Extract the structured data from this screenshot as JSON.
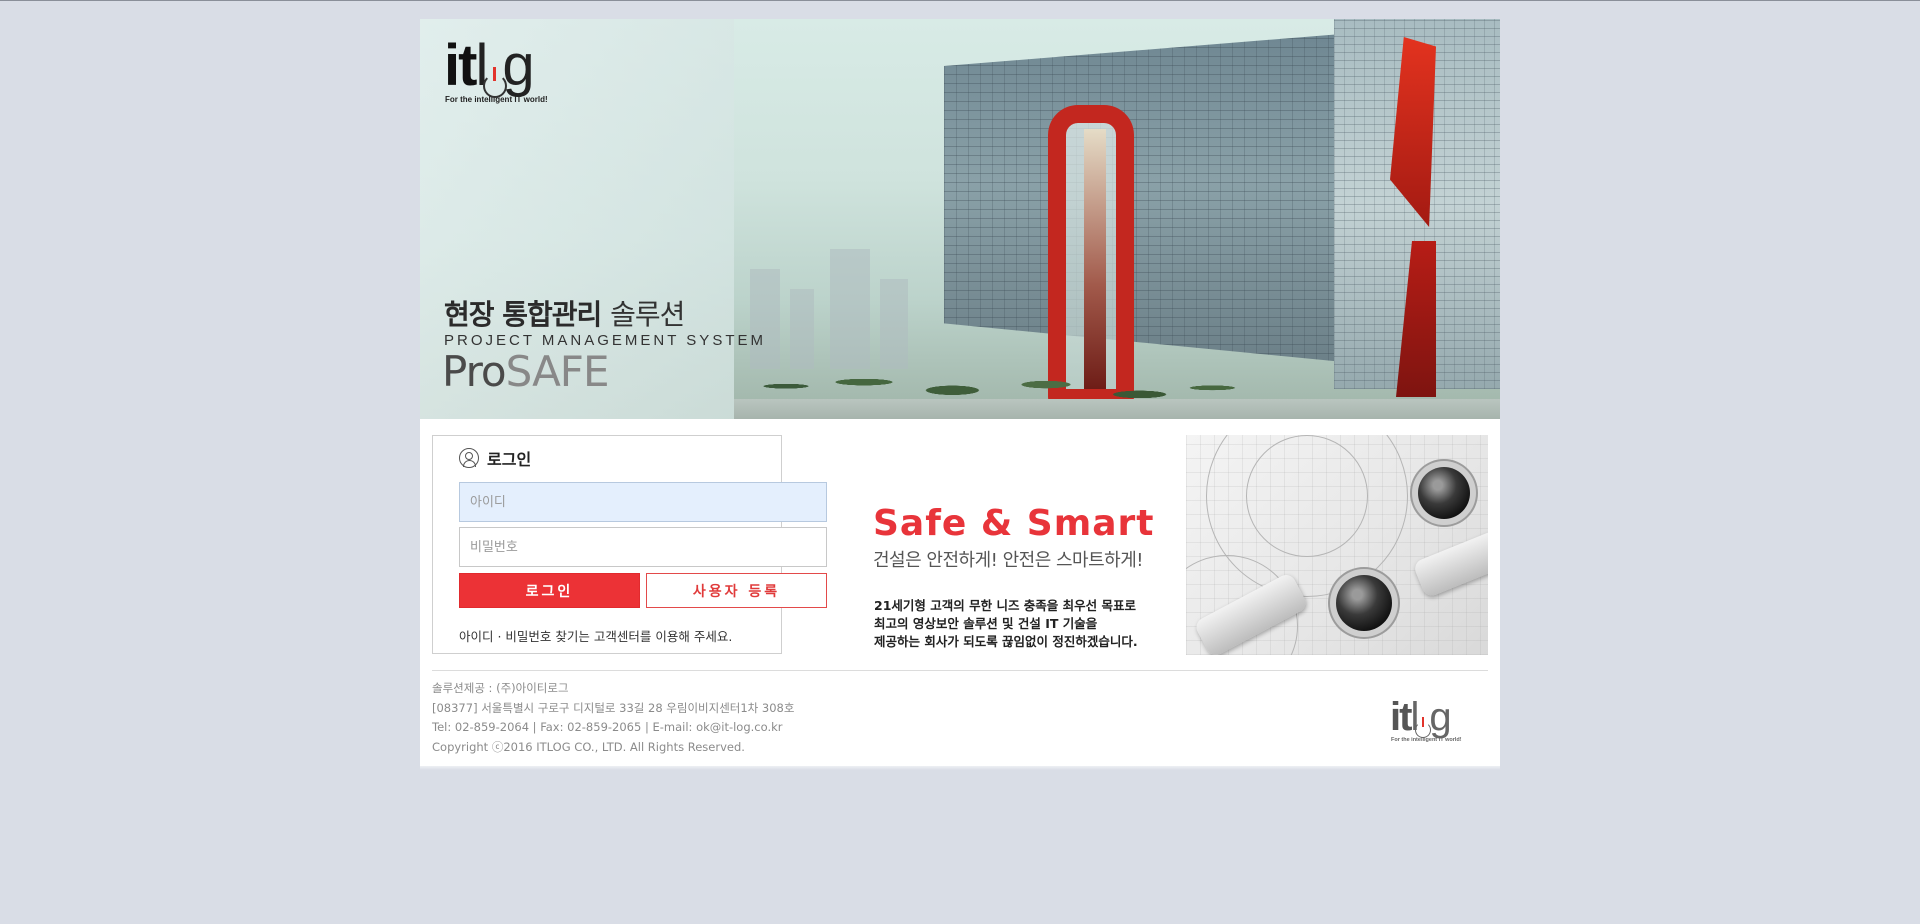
{
  "brand": {
    "logo_it": "it",
    "logo_lg": "lg",
    "logo_tagline": "For the intelligent IT world!"
  },
  "hero": {
    "title_bold": "현장 통합관리",
    "title_light": "솔루션",
    "subtitle": "PROJECT MANAGEMENT SYSTEM",
    "product_pro": "Pro",
    "product_safe": "SAFE"
  },
  "login": {
    "title": "로그인",
    "id_placeholder": "아이디",
    "password_placeholder": "비밀번호",
    "login_button": "로그인",
    "register_button": "사용자 등록",
    "note": "아이디 · 비밀번호 찾기는 고객센터를 이용해 주세요."
  },
  "slogan": {
    "title": "Safe & Smart",
    "subtitle": "건설은 안전하게! 안전은 스마트하게!",
    "desc": [
      "21세기형 고객의 무한 니즈 충족을 최우선 목표로",
      "최고의 영상보안 솔루션 및 건설 IT 기술을",
      "제공하는 회사가 되도록 끊임없이 정진하겠습니다."
    ]
  },
  "footer": {
    "lines": [
      "솔루션제공 : (주)아이티로그",
      "[08377] 서울특별시 구로구 디지털로 33길 28 우림이비지센터1차 308호",
      "Tel: 02-859-2064 | Fax: 02-859-2065 | E-mail: ok@it-log.co.kr",
      "Copyright ⓒ2016 ITLOG CO., LTD. All Rights Reserved."
    ]
  },
  "colors": {
    "page_bg": "#d9dde6",
    "accent_red": "#ec3236",
    "id_field_bg": "#e4effd"
  }
}
